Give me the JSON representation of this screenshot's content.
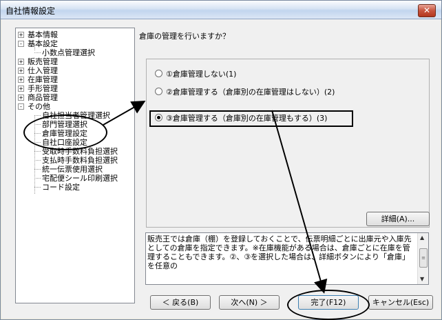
{
  "window": {
    "title": "自社情報設定",
    "close_glyph": "✕"
  },
  "tree": {
    "items": [
      {
        "label": "基本情報",
        "expander": "+"
      },
      {
        "label": "基本設定",
        "expander": "-"
      },
      {
        "label": "小数点管理選択",
        "expander": ""
      },
      {
        "label": "販売管理",
        "expander": "+"
      },
      {
        "label": "仕入管理",
        "expander": "+"
      },
      {
        "label": "在庫管理",
        "expander": "+"
      },
      {
        "label": "手形管理",
        "expander": "+"
      },
      {
        "label": "商品管理",
        "expander": "+"
      },
      {
        "label": "その他",
        "expander": "-"
      },
      {
        "label": "自社担当者管理選択",
        "expander": ""
      },
      {
        "label": "部門管理選択",
        "expander": ""
      },
      {
        "label": "倉庫管理設定",
        "expander": ""
      },
      {
        "label": "自社口座設定",
        "expander": ""
      },
      {
        "label": "受取時手数料負担選択",
        "expander": ""
      },
      {
        "label": "支払時手数料負担選択",
        "expander": ""
      },
      {
        "label": "統一伝票使用選択",
        "expander": ""
      },
      {
        "label": "宅配便シール印刷選択",
        "expander": ""
      },
      {
        "label": "コード設定",
        "expander": ""
      }
    ]
  },
  "question": "倉庫の管理を行いますか？",
  "options": [
    {
      "label": "①倉庫管理しない(1)",
      "selected": false
    },
    {
      "label": "②倉庫管理する（倉庫別の在庫管理はしない）(2)",
      "selected": false
    },
    {
      "label": "③倉庫管理する（倉庫別の在庫管理もする）(3)",
      "selected": true
    }
  ],
  "detail_button": "詳細(A)...",
  "description": "販売王では倉庫（棚）を登録しておくことで、伝票明細ごとに出庫元や入庫先としての倉庫を指定できます。※在庫機能がある場合は、倉庫ごとに在庫を管理することもできます。②、③を選択した場合は、詳細ボタンにより「倉庫」を任意の",
  "scrollbar": {
    "up": "▲",
    "down": "▼",
    "grip": "≡"
  },
  "buttons": {
    "back": "＜ 戻る(B)",
    "next": "次へ(N) ＞",
    "finish": "完了(F12)",
    "cancel": "キャンセル(Esc)"
  },
  "colors": {
    "annotation": "#000000",
    "titlebar": "#d6e3f3"
  }
}
